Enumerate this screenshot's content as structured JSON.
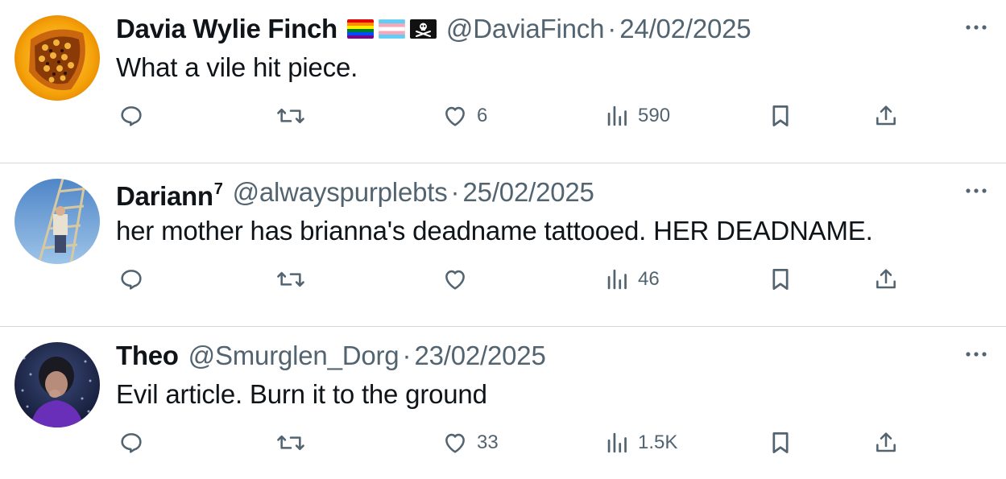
{
  "tweets": [
    {
      "name": "Davia Wylie Finch",
      "name_sup": "",
      "flags": [
        "rainbow-flag",
        "transgender-flag",
        "pirate-flag"
      ],
      "handle": "@DaviaFinch",
      "separator": "·",
      "date": "24/02/2025",
      "text": "What a vile hit piece.",
      "likes": "6",
      "views": "590",
      "avatar_desc_icon": "butterfly-avatar"
    },
    {
      "name": "Dariann",
      "name_sup": "7",
      "flags": [],
      "handle": "@alwayspurplebts",
      "separator": "·",
      "date": "25/02/2025",
      "text": "her mother has brianna's deadname tattooed. HER DEADNAME.",
      "likes": "",
      "views": "46",
      "avatar_desc_icon": "tower-avatar"
    },
    {
      "name": "Theo",
      "name_sup": "",
      "flags": [],
      "handle": "@Smurglen_Dorg",
      "separator": "·",
      "date": "23/02/2025",
      "text": "Evil article. Burn it to the ground",
      "likes": "33",
      "views": "1.5K",
      "avatar_desc_icon": "portrait-avatar"
    }
  ],
  "colors": {
    "text": "#0f1419",
    "secondary": "#536471",
    "divider": "#cfd9de"
  },
  "icons": {
    "reply": "reply-icon",
    "retweet": "retweet-icon",
    "like": "heart-icon",
    "views": "views-icon",
    "bookmark": "bookmark-icon",
    "share": "share-icon",
    "more": "more-icon"
  }
}
